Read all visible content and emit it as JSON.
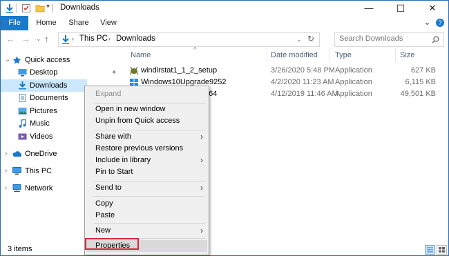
{
  "window": {
    "title": "Downloads",
    "buttons": {
      "minimize": "—",
      "maximize": "☐",
      "close": "✕"
    }
  },
  "ribbon": {
    "tabs": [
      "File",
      "Home",
      "Share",
      "View"
    ],
    "expand": "⌄",
    "help": "?"
  },
  "address": {
    "crumbs": [
      "This PC",
      "Downloads"
    ],
    "search_placeholder": "Search Downloads"
  },
  "nav": {
    "quick_access": "Quick access",
    "items": [
      "Desktop",
      "Downloads",
      "Documents",
      "Pictures",
      "Music",
      "Videos"
    ],
    "onedrive": "OneDrive",
    "this_pc": "This PC",
    "network": "Network"
  },
  "columns": {
    "name": "Name",
    "date": "Date modified",
    "type": "Type",
    "size": "Size"
  },
  "files": [
    {
      "name": "windirstat1_1_2_setup",
      "date": "3/26/2020 5:48 PM",
      "type": "Application",
      "size": "627 KB"
    },
    {
      "name": "Windows10Upgrade9252",
      "date": "4/2/2020 11:23 AM",
      "type": "Application",
      "size": "6,115 KB"
    },
    {
      "name": "p64",
      "date": "4/12/2019 11:46 AM",
      "type": "Application",
      "size": "49,501 KB"
    }
  ],
  "status": {
    "items": "3 items"
  },
  "context_menu": {
    "expand": "Expand",
    "open_new_window": "Open in new window",
    "unpin": "Unpin from Quick access",
    "share_with": "Share with",
    "restore": "Restore previous versions",
    "include_library": "Include in library",
    "pin_start": "Pin to Start",
    "send_to": "Send to",
    "copy": "Copy",
    "paste": "Paste",
    "new": "New",
    "properties": "Properties",
    "submenu_arrow": "›"
  },
  "colors": {
    "accent": "#1979ca",
    "selection": "#cce8ff",
    "highlight": "#d22a3a"
  }
}
